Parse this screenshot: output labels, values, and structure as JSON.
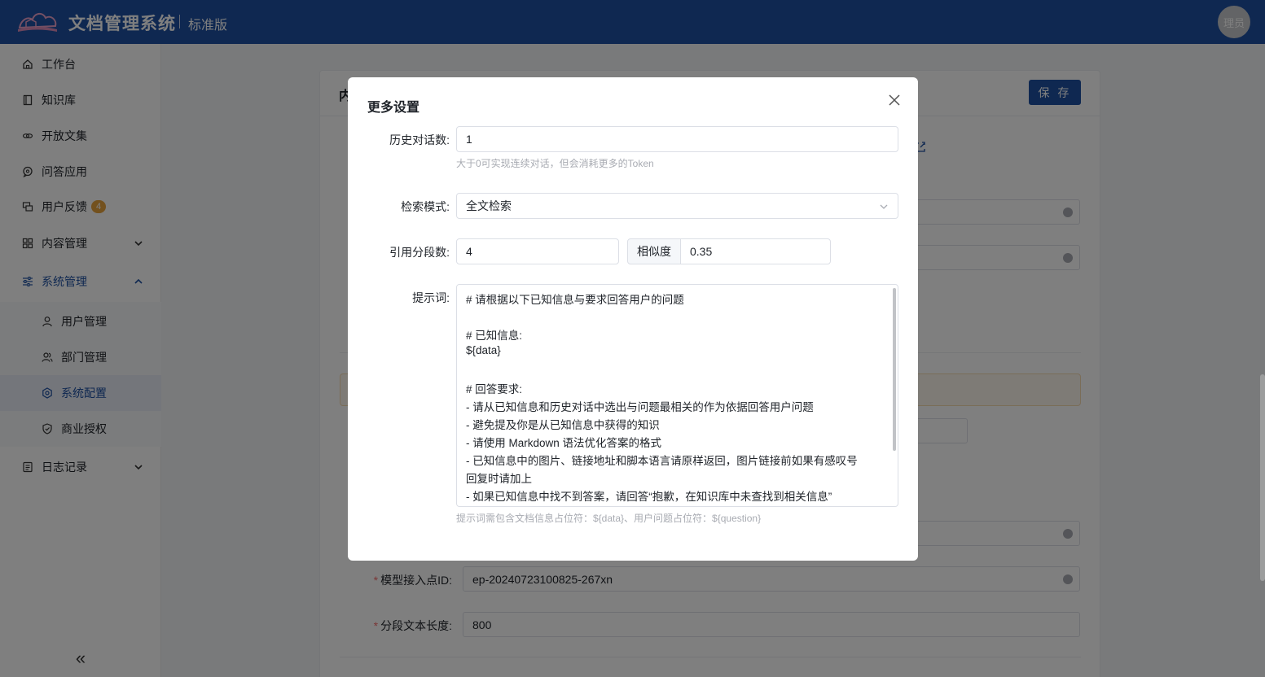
{
  "header": {
    "app_title": "文档管理系统",
    "edition": "标准版",
    "avatar_text": "理员",
    "brand_color": "#1e50a2"
  },
  "sidebar": {
    "items": [
      {
        "label": "工作台",
        "icon": "home-icon"
      },
      {
        "label": "知识库",
        "icon": "book-icon"
      },
      {
        "label": "开放文集",
        "icon": "link-icon"
      },
      {
        "label": "问答应用",
        "icon": "chat-icon"
      },
      {
        "label": "用户反馈",
        "icon": "feedback-icon",
        "badge": "4"
      },
      {
        "label": "内容管理",
        "icon": "grid-icon"
      },
      {
        "label": "系统管理",
        "icon": "sliders-icon"
      },
      {
        "label": "日志记录",
        "icon": "log-icon"
      }
    ],
    "sub_items": [
      {
        "label": "用户管理",
        "icon": "user-icon"
      },
      {
        "label": "部门管理",
        "icon": "users-icon"
      },
      {
        "label": "系统配置",
        "icon": "gear-icon"
      },
      {
        "label": "商业授权",
        "icon": "shield-icon"
      }
    ],
    "collapse_glyph": "«"
  },
  "background": {
    "card_title": "内",
    "save_label": "保 存",
    "fields": {
      "endpoint_label": "模型接入点ID:",
      "endpoint_value": "ep-20240723100825-267xn",
      "chunk_label": "分段文本长度:",
      "chunk_value": "800"
    }
  },
  "modal": {
    "title": "更多设置",
    "history_label": "历史对话数:",
    "history_value": "1",
    "history_hint": "大于0可实现连续对话，但会消耗更多的Token",
    "search_mode_label": "检索模式:",
    "search_mode_value": "全文检索",
    "segments_label": "引用分段数:",
    "segments_value": "4",
    "similarity_label": "相似度",
    "similarity_value": "0.35",
    "prompt_label": "提示词:",
    "prompt_lines": [
      "# 请根据以下已知信息与要求回答用户的问题",
      "",
      "# 已知信息:",
      "${data}",
      "",
      "# 回答要求:",
      "- 请从已知信息和历史对话中选出与问题最相关的作为依据回答用户问题",
      "- 避免提及你是从已知信息中获得的知识",
      "- 请使用 Markdown 语法优化答案的格式",
      "- 已知信息中的图片、链接地址和脚本语言请原样返回，图片链接前如果有感叹号",
      "回复时请加上",
      "- 如果已知信息中找不到答案，请回答“抱歉，在知识库中未查找到相关信息”"
    ],
    "prompt_hint": "提示词需包含文档信息占位符：${data}、用户问题占位符：${question}"
  }
}
